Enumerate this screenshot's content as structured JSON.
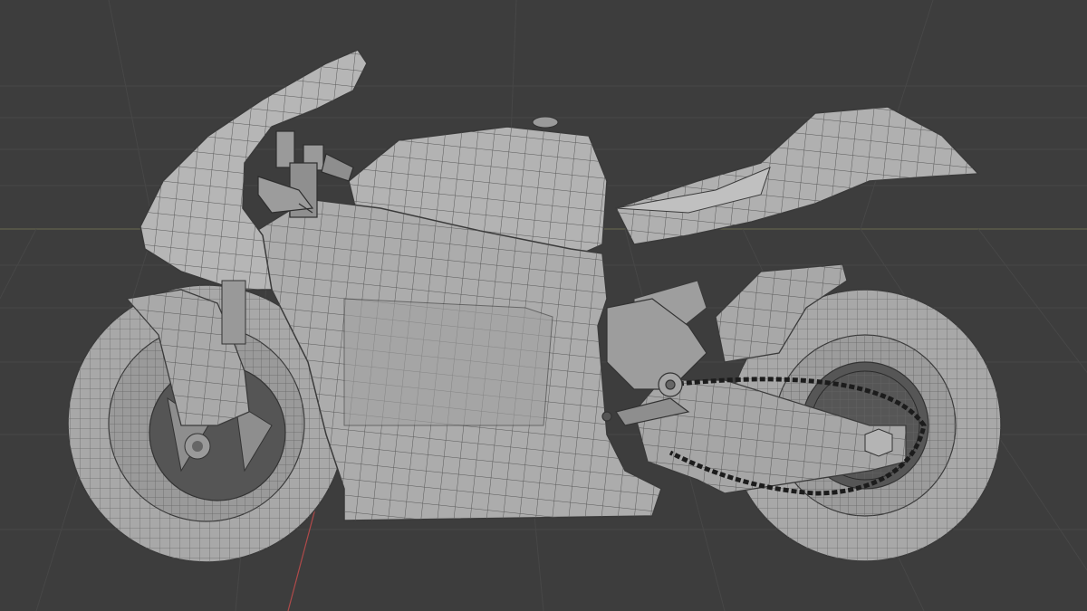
{
  "viewport": {
    "background": "#3d3d3d",
    "grid_color": "#4a4a4a",
    "horizon_line_color": "#6b6b4f",
    "axis_line_color": "#b04a4a"
  },
  "model": {
    "surface_color": "#a9a9a9",
    "surface_light": "#bdbdbd",
    "surface_dark": "#8c8c8c",
    "wire_color": "#3a3a3a",
    "chain_color": "#1c1c1c",
    "shading_mode": "solid-wireframe"
  }
}
